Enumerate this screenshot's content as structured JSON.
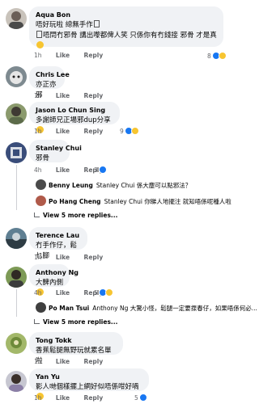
{
  "comments": [
    {
      "author": "Aqua Bon",
      "lines": [
        "唔好玩啦 總無手作",
        "唔問冇邪骨 講出嚟都俾人笑 只係你有冇錢接 邪骨 才是真"
      ],
      "time": "1h",
      "like": "Like",
      "reply": "Reply",
      "reactions": "8"
    },
    {
      "author": "Chris Lee",
      "lines": [
        "亦正亦邪"
      ],
      "time": "1h",
      "like": "Like",
      "reply": "Reply"
    },
    {
      "author": "Jason Lo Chun Sing",
      "lines": [
        "多謝師兄正場邪dup分享"
      ],
      "time": "1h",
      "like": "Like",
      "reply": "Reply",
      "reactions": "9"
    },
    {
      "author": "Stanley Chui",
      "lines": [
        "邪骨"
      ],
      "time": "4h",
      "like": "Like",
      "reply": "Reply",
      "reactions": "3"
    },
    {
      "author": "Terence Lau",
      "lines": [
        "冇手作仔，鬆乜腳"
      ],
      "time": "1h",
      "like": "Like",
      "reply": "Reply"
    },
    {
      "author": "Anthony Ng",
      "lines": [
        "大髀內側"
      ],
      "time": "4h",
      "like": "Like",
      "reply": "Reply",
      "reactions": "5"
    },
    {
      "author": "Tong Tokk",
      "lines": [
        "香蕉鬆腿無野玩就累名單啦"
      ],
      "time": "1h",
      "like": "Like",
      "reply": "Reply"
    },
    {
      "author": "Yan Yu",
      "lines": [
        "影人哋個樣擺上網好似唔係咁好喎"
      ],
      "time": "1h",
      "like": "Like",
      "reply": "Reply",
      "reactions": "5"
    }
  ],
  "replies": {
    "stanley_1": {
      "author": "Benny Leung",
      "text": "Stanley Chui 係大塵可以點邪法？"
    },
    "stanley_2": {
      "author": "Po Hang Cheng",
      "text": "Stanley Chui 你睇人地擺注 就知唔係呢種人啦"
    },
    "stanley_more": "View 5 more replies...",
    "anthony_1": {
      "author": "Po Man Tsui",
      "text": "Anthony Ng 大驚小怪，鬆腿一定要揼春仔，如果唔係何必..."
    },
    "anthony_more": "View 5 more replies..."
  },
  "colors": {
    "bubble": "#f0f2f5",
    "meta": "#65676b",
    "like_icon": "#1877f2",
    "haha_icon": "#f7c531"
  },
  "icons": {
    "like": "like-reaction-icon",
    "haha": "haha-reaction-icon",
    "reply": "reply-arrow-icon"
  }
}
